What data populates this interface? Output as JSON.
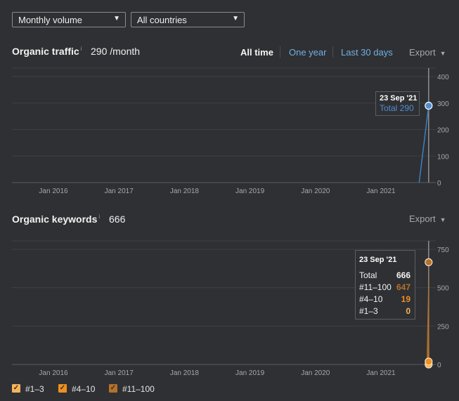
{
  "filters": {
    "volume": "Monthly volume",
    "country": "All countries"
  },
  "traffic": {
    "title": "Organic traffic",
    "info": "i",
    "value": "290 /month",
    "ranges": [
      "All time",
      "One year",
      "Last 30 days"
    ],
    "export": "Export",
    "tooltip": {
      "date": "23 Sep '21",
      "total": "Total 290"
    }
  },
  "keywords": {
    "title": "Organic keywords",
    "info": "i",
    "value": "666",
    "export": "Export",
    "tooltip": {
      "date": "23 Sep '21",
      "rows": [
        {
          "label": "Total",
          "value": "666",
          "color": "#f2f2f2"
        },
        {
          "label": "#11–100",
          "value": "647",
          "color": "#b5712a"
        },
        {
          "label": "#4–10",
          "value": "19",
          "color": "#f0901f"
        },
        {
          "label": "#1–3",
          "value": "0",
          "color": "#f6b35c"
        }
      ]
    }
  },
  "legend": [
    {
      "label": "#1–3",
      "color": "#f6b35c"
    },
    {
      "label": "#4–10",
      "color": "#f0901f"
    },
    {
      "label": "#11–100",
      "color": "#b5712a"
    }
  ],
  "chart_data": [
    {
      "type": "line",
      "title": "Organic traffic",
      "x_ticks": [
        "Jan 2016",
        "Jan 2017",
        "Jan 2018",
        "Jan 2019",
        "Jan 2020",
        "Jan 2021"
      ],
      "y_ticks": [
        0,
        100,
        200,
        300,
        400
      ],
      "ylim": [
        0,
        400
      ],
      "grid": true,
      "series": [
        {
          "name": "Total",
          "color": "#3d7ec4",
          "points": [
            [
              "2021-08-01",
              0
            ],
            [
              "2021-09-23",
              290
            ]
          ]
        }
      ]
    },
    {
      "type": "area",
      "title": "Organic keywords",
      "x_ticks": [
        "Jan 2016",
        "Jan 2017",
        "Jan 2018",
        "Jan 2019",
        "Jan 2020",
        "Jan 2021"
      ],
      "y_ticks": [
        0,
        250,
        500,
        750
      ],
      "ylim": [
        0,
        750
      ],
      "grid": true,
      "series": [
        {
          "name": "#1–3",
          "color": "#f6b35c",
          "points": [
            [
              "2021-09-23",
              0
            ]
          ]
        },
        {
          "name": "#4–10",
          "color": "#f0901f",
          "points": [
            [
              "2021-09-23",
              19
            ]
          ]
        },
        {
          "name": "#11–100",
          "color": "#b5712a",
          "points": [
            [
              "2021-09-23",
              647
            ]
          ]
        }
      ]
    }
  ],
  "colors": {
    "background": "#2f3033",
    "traffic_line": "#3d7ec4",
    "link": "#6fb0e6",
    "keywords_line": "#d08a3a"
  }
}
